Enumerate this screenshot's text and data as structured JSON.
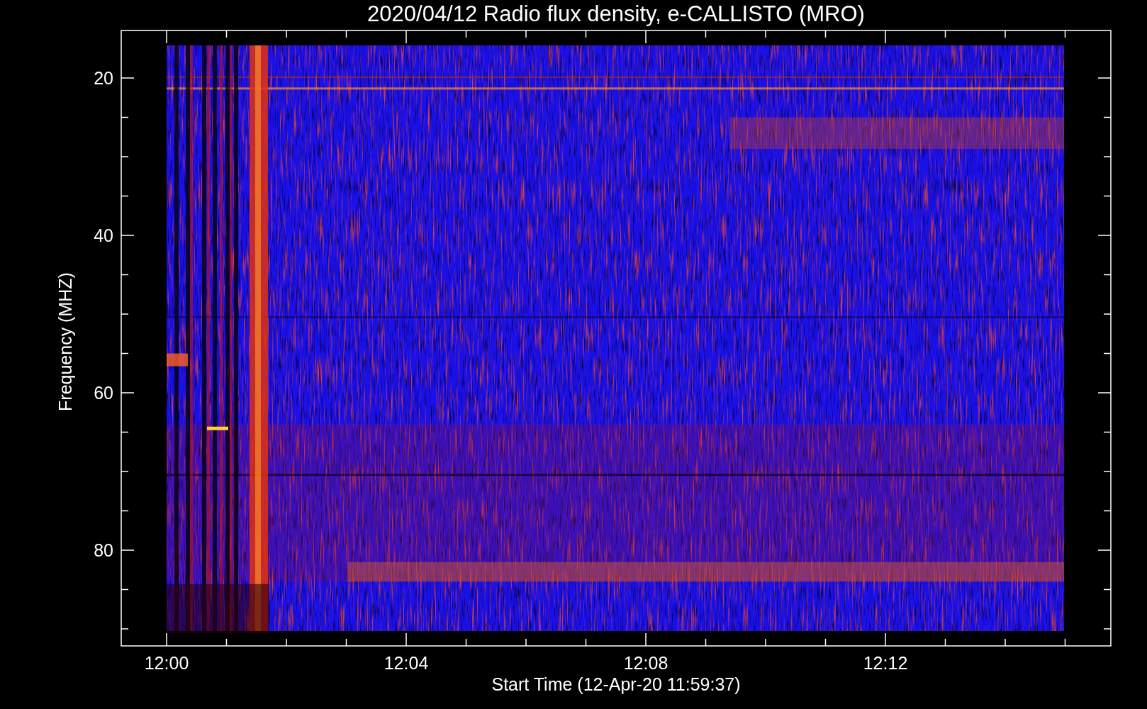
{
  "plot": {
    "title": "2020/04/12  Radio flux density, e-CALLISTO (MRO)",
    "ylabel": "Frequency (MHZ)",
    "xlabel": "Start Time (12-Apr-20 11:59:37)",
    "yticks": [
      "20",
      "40",
      "60",
      "80"
    ],
    "xticks": [
      "12:00",
      "12:04",
      "12:08",
      "12:12"
    ]
  }
}
